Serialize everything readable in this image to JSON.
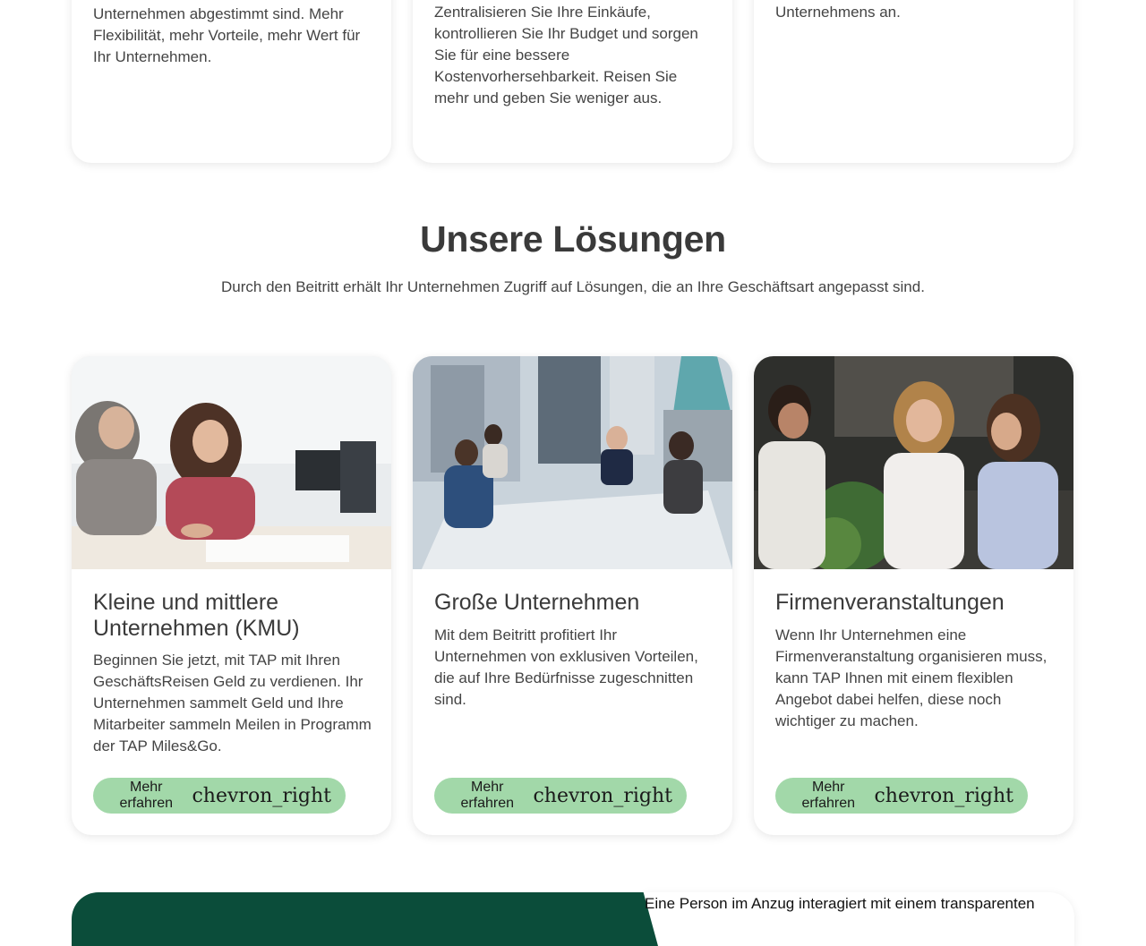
{
  "top_cards": [
    {
      "lines": [
        "Unternehmen abgestimmt sind. Mehr",
        "Flexibilität, mehr Vorteile, mehr Wert für",
        "Ihr Unternehmen."
      ]
    },
    {
      "lines": [
        "Zentralisieren Sie Ihre Einkäufe,",
        "kontrollieren Sie Ihr Budget und sorgen",
        "Sie für eine bessere",
        "Kostenvorhersehbarkeit. Reisen Sie",
        "mehr und geben Sie weniger aus."
      ]
    },
    {
      "lines": [
        "Unternehmens an."
      ]
    }
  ],
  "solutions": {
    "title": "Unsere Lösungen",
    "subtitle": "Durch den Beitritt erhält Ihr Unternehmen Zugriff auf Lösungen, die an Ihre Geschäftsart angepasst sind.",
    "cards": [
      {
        "title": "Kleine und mittlere Unternehmen (KMU)",
        "description": "Beginnen Sie jetzt, mit TAP mit Ihren GeschäftsReisen Geld zu verdienen. Ihr Unternehmen sammelt Geld und Ihre Mitarbeiter sammeln Meilen in Programm der TAP Miles&Go.",
        "button_label": "Mehr erfahren",
        "button_icon": "chevron_right"
      },
      {
        "title": "Große Unternehmen",
        "description": "Mit dem Beitritt profitiert Ihr Unternehmen von exklusiven Vorteilen, die auf Ihre Bedürfnisse zugeschnitten sind.",
        "button_label": "Mehr erfahren",
        "button_icon": "chevron_right"
      },
      {
        "title": "Firmenveranstaltungen",
        "description": "Wenn Ihr Unternehmen eine Firmenveranstaltung organisieren muss, kann TAP Ihnen mit einem flexiblen Angebot dabei helfen, diese noch wichtiger zu machen.",
        "button_label": "Mehr erfahren",
        "button_icon": "chevron_right"
      }
    ]
  },
  "banner": {
    "image_alt": "Eine Person im Anzug interagiert mit einem transparenten"
  },
  "colors": {
    "button_bg": "#a2d8a9",
    "banner_green": "#0b4d3a",
    "text": "#3f3f3f"
  }
}
